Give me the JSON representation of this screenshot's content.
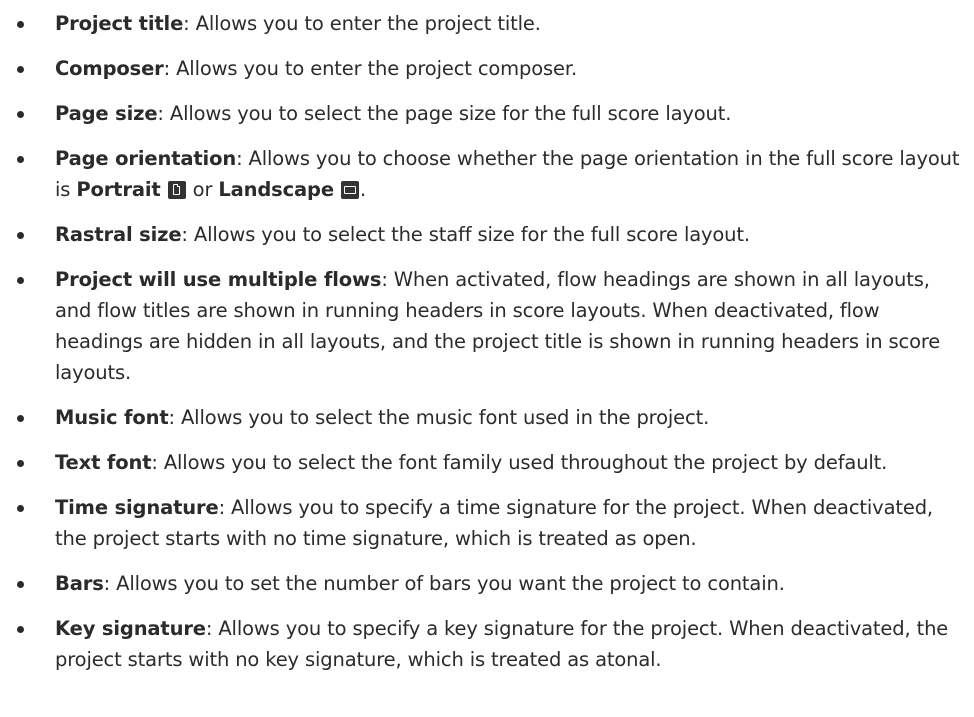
{
  "items": [
    {
      "term": "Project title",
      "desc": ": Allows you to enter the project title."
    },
    {
      "term": "Composer",
      "desc": ": Allows you to enter the project composer."
    },
    {
      "term": "Page size",
      "desc": ": Allows you to select the page size for the full score layout."
    },
    {
      "term": "Page orientation",
      "desc": ": Allows you to choose whether the page orientation in the full score layout is ",
      "opt1": "Portrait",
      "mid": " or ",
      "opt2": "Landscape",
      "end": "."
    },
    {
      "term": "Rastral size",
      "desc": ": Allows you to select the staff size for the full score layout."
    },
    {
      "term": "Project will use multiple flows",
      "desc": ": When activated, flow headings are shown in all layouts, and flow titles are shown in running headers in score layouts. When deactivated, flow headings are hidden in all layouts, and the project title is shown in running headers in score layouts."
    },
    {
      "term": "Music font",
      "desc": ": Allows you to select the music font used in the project."
    },
    {
      "term": "Text font",
      "desc": ": Allows you to select the font family used throughout the project by default."
    },
    {
      "term": "Time signature",
      "desc": ": Allows you to specify a time signature for the project. When deactivated, the project starts with no time signature, which is treated as open."
    },
    {
      "term": "Bars",
      "desc": ": Allows you to set the number of bars you want the project to contain."
    },
    {
      "term": "Key signature",
      "desc": ": Allows you to specify a key signature for the project. When deactivated, the project starts with no key signature, which is treated as atonal."
    }
  ],
  "icons": {
    "portrait": "portrait-page-icon",
    "landscape": "landscape-page-icon"
  }
}
